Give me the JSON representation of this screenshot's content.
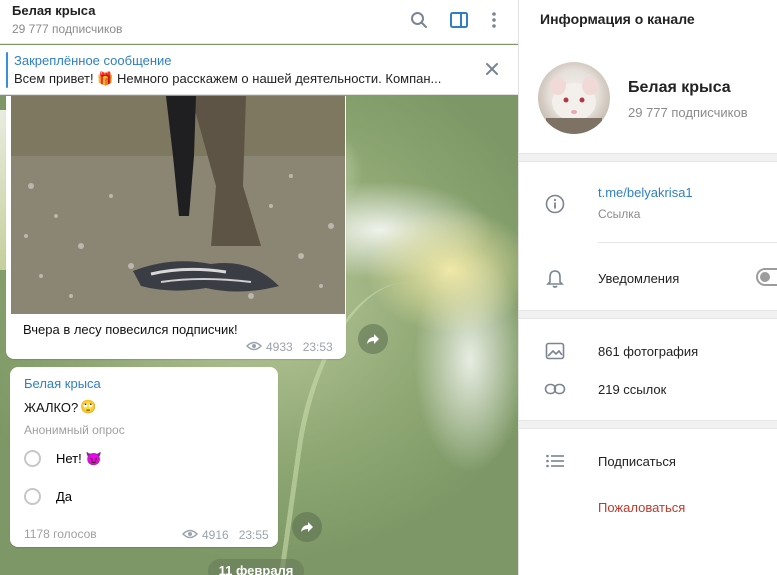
{
  "chat": {
    "title": "Белая крыса",
    "subtitle": "29 777 подписчиков",
    "pinned": {
      "label": "Закреплённое сообщение",
      "text": "Всем привет! 🎁 Немного расскажем о нашей деятельности. Компан..."
    },
    "messages": [
      {
        "type": "photo",
        "caption": "Вчера в лесу повесился подписчик!",
        "views": "4933",
        "time": "23:53"
      },
      {
        "type": "poll",
        "author": "Белая крыса",
        "question": "ЖАЛКО?",
        "question_emoji": "🙄",
        "poll_type": "Анонимный опрос",
        "options": [
          {
            "text": "Нет!",
            "emoji": "😈"
          },
          {
            "text": "Да",
            "emoji": ""
          }
        ],
        "votes": "1178 голосов",
        "views": "4916",
        "time": "23:55"
      }
    ],
    "date_pill": "11 февраля"
  },
  "panel": {
    "title": "Информация о канале",
    "channel_name": "Белая крыса",
    "channel_subs": "29 777 подписчиков",
    "link": "t.me/belyakrisa1",
    "link_label": "Ссылка",
    "notifications": "Уведомления",
    "notifications_on": false,
    "photos": "861 фотография",
    "links": "219 ссылок",
    "subscribe": "Подписаться",
    "report": "Пожаловаться"
  },
  "icons": {
    "search": "search-icon",
    "sidebar_toggle": "sidebar-toggle-icon",
    "more": "more-vertical-icon",
    "close": "close-icon",
    "forward": "forward-icon",
    "views": "eye-icon",
    "info": "info-icon",
    "bell": "bell-icon",
    "photo": "photo-icon",
    "link": "link-icon",
    "list": "list-icon"
  },
  "colors": {
    "accent": "#2f7fc4",
    "report": "#c0392b"
  }
}
